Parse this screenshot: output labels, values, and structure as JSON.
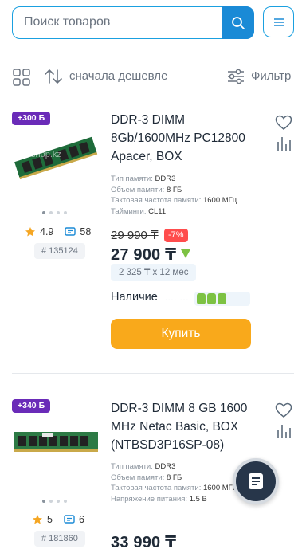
{
  "search": {
    "placeholder": "Поиск товаров"
  },
  "toolbar": {
    "sort_label": "сначала дешевле",
    "filter_label": "Фильтр"
  },
  "products": [
    {
      "bonus": "+300 Б",
      "title": "DDR-3 DIMM 8Gb/1600MHz PC12800 Apacer, BOX",
      "image_watermark": "shop.kz",
      "specs": [
        {
          "label": "Тип памяти:",
          "value": "DDR3"
        },
        {
          "label": "Объем памяти:",
          "value": "8 ГБ"
        },
        {
          "label": "Тактовая частота памяти:",
          "value": "1600 МГц"
        },
        {
          "label": "Тайминги:",
          "value": "CL11"
        }
      ],
      "rating": "4.9",
      "reviews": "58",
      "sku": "# 135124",
      "old_price": "29 990 ₸",
      "discount": "-7%",
      "price": "27 900 ₸",
      "installment": "2 325 ₸ x 12 мес",
      "stock_label": "Наличие",
      "stock_level": 3,
      "stock_max": 5,
      "buy_label": "Купить"
    },
    {
      "bonus": "+340 Б",
      "title": "DDR-3 DIMM 8 GB 1600 MHz Netac Basic, BOX (NTBSD3P16SP-08)",
      "specs": [
        {
          "label": "Тип памяти:",
          "value": "DDR3"
        },
        {
          "label": "Объем памяти:",
          "value": "8 ГБ"
        },
        {
          "label": "Тактовая частота памяти:",
          "value": "1600 МГц"
        },
        {
          "label": "Напряжение питания:",
          "value": "1.5 В"
        }
      ],
      "rating": "5",
      "reviews": "6",
      "sku": "# 181860",
      "price": "33 990 ₸"
    }
  ],
  "colors": {
    "accent": "#1a8ad6",
    "bonus": "#6a2bb8",
    "buy": "#f9a91b",
    "discount": "#ff4d4d",
    "stock": "#7dc243",
    "star": "#f5a623"
  }
}
